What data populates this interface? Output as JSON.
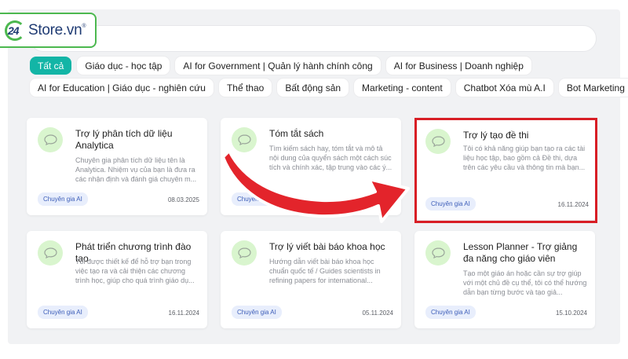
{
  "logo": {
    "number": "24",
    "brand": "Store.vn",
    "registered": "®"
  },
  "search": {
    "placeholder": ""
  },
  "categories": [
    {
      "label": "Tất cả",
      "active": true
    },
    {
      "label": "Giáo dục - học tập"
    },
    {
      "label": "AI for Government | Quản lý hành chính công"
    },
    {
      "label": "AI for Business | Doanh nghiệp"
    },
    {
      "label": "AI for Education | Giáo dục - nghiên cứu"
    },
    {
      "label": "Thể thao"
    },
    {
      "label": "Bất động sản"
    },
    {
      "label": "Marketing - content"
    },
    {
      "label": "Chatbot Xóa mù A.I"
    },
    {
      "label": "Bot Marketing"
    }
  ],
  "cards": [
    {
      "title": "Trợ lý phân tích dữ liệu Analytica",
      "desc": "Chuyên gia phân tích dữ liệu tên là Analytica. Nhiệm vụ của bạn là đưa ra các nhận định và đánh giá chuyên m...",
      "tag": "Chuyên gia AI",
      "date": "08.03.2025"
    },
    {
      "title": "Tóm tắt sách",
      "desc": "Tìm kiếm sách hay, tóm tắt và mô tả nội dung của quyển sách một cách súc tích và chính xác, tập trung vào các ý...",
      "tag": "Chuyên gia AI",
      "date": ""
    },
    {
      "title": "Trợ lý tạo đề thi",
      "desc": "Tôi có khả năng giúp bạn tạo ra các tài liệu học tập, bao gồm cả Đề thi, dựa trên các yêu cầu và thông tin mà bạn...",
      "tag": "Chuyên gia AI",
      "date": "16.11.2024"
    },
    {
      "title": "Phát triển chương trình đào tạo",
      "desc": "Tôi được thiết kế để hỗ trợ bạn trong việc tạo ra và cải thiện các chương trình học, giúp cho quá trình giáo dụ...",
      "tag": "Chuyên gia AI",
      "date": "16.11.2024"
    },
    {
      "title": "Trợ lý viết bài báo khoa học",
      "desc": "Hướng dẫn viết bài báo khoa học chuẩn quốc tế / Guides scientists in refining papers for international...",
      "tag": "Chuyên gia AI",
      "date": "05.11.2024"
    },
    {
      "title": "Lesson Planner - Trợ giảng đa năng cho giáo viên",
      "desc": "Tạo một giáo án hoặc cần sự trợ giúp với một chủ đề cụ thể, tôi có thể hướng dẫn bạn từng bước và tạo giả...",
      "tag": "Chuyên gia AI",
      "date": "15.10.2024"
    }
  ],
  "colors": {
    "accent": "#13b5a6",
    "highlight": "#d81e25",
    "brand_green": "#4cb84f",
    "brand_navy": "#1f3b73"
  }
}
